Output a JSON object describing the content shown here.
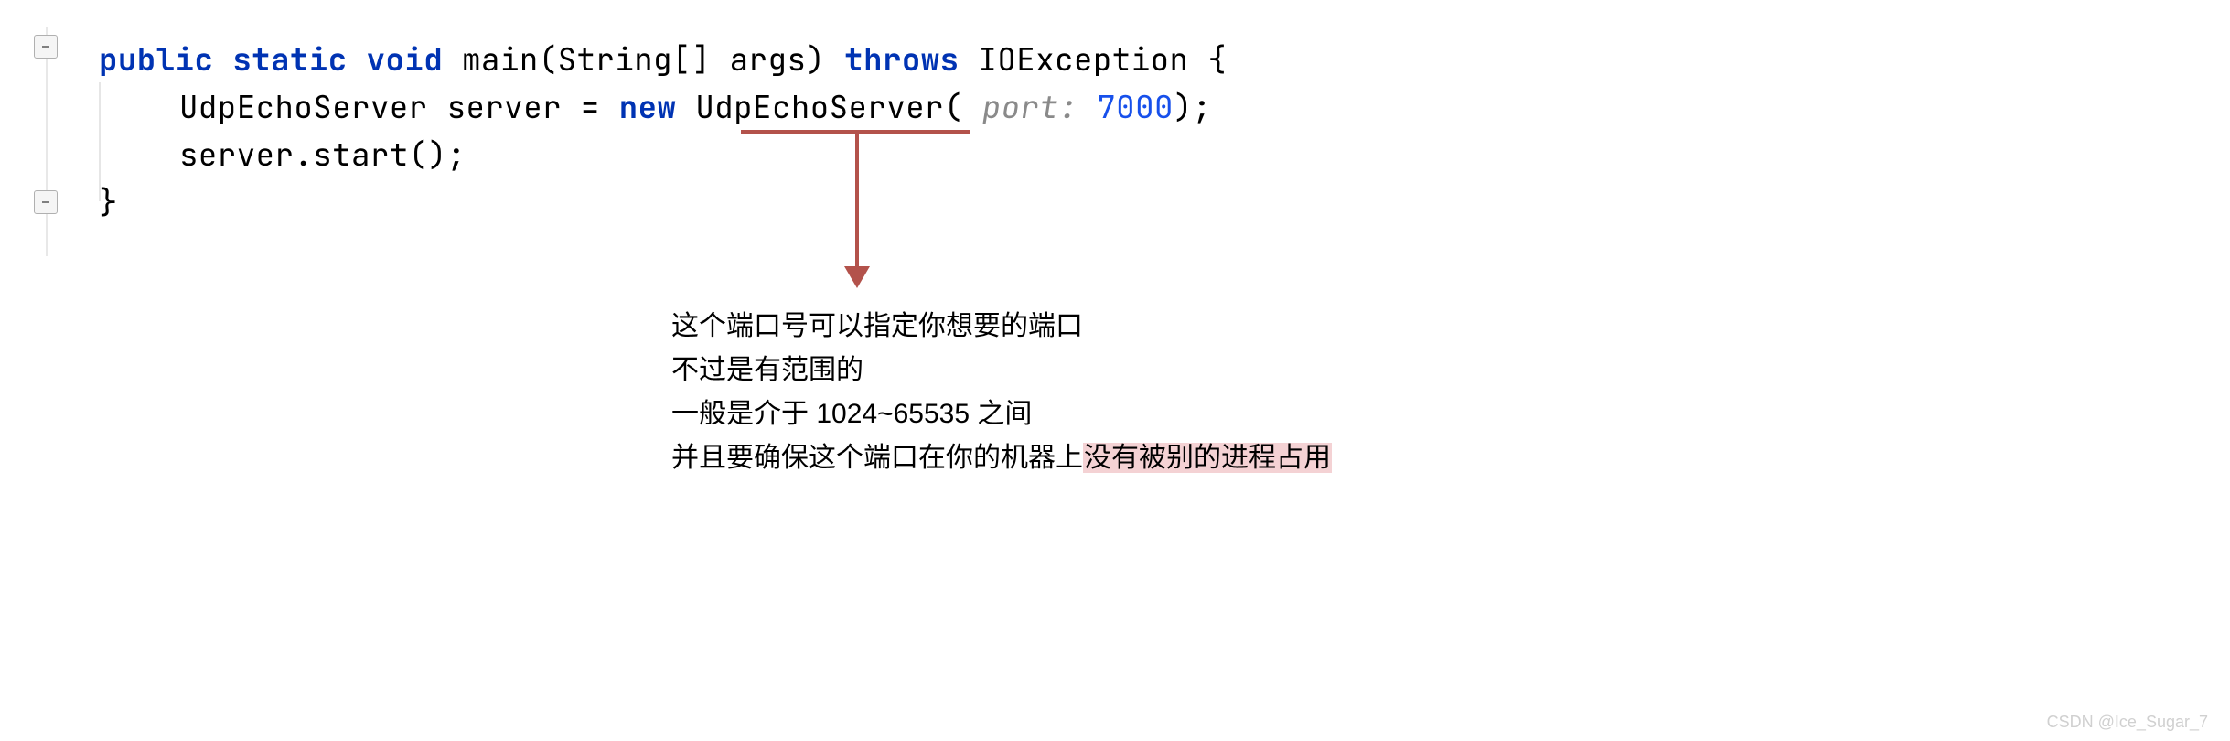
{
  "code": {
    "line1": {
      "kw1": "public",
      "kw2": "static",
      "kw3": "void",
      "method": "main",
      "paramType": "String[]",
      "paramName": "args",
      "kw4": "throws",
      "exception": "IOException",
      "brace": "{"
    },
    "line2": {
      "type": "UdpEchoServer",
      "var": "server",
      "eq": "=",
      "kw": "new",
      "ctor": "UdpEchoServer",
      "hint": " port: ",
      "val": "7000",
      "close": ");"
    },
    "line3": {
      "expr": "server.start();"
    },
    "line4": {
      "brace": "}"
    }
  },
  "annotation": {
    "l1": "这个端口号可以指定你想要的端口",
    "l2": "不过是有范围的",
    "l3": "一般是介于 1024~65535 之间",
    "l4a": "并且要确保这个端口在你的机器上",
    "l4b": "没有被别的进程占用"
  },
  "watermark": "CSDN @Ice_Sugar_7"
}
